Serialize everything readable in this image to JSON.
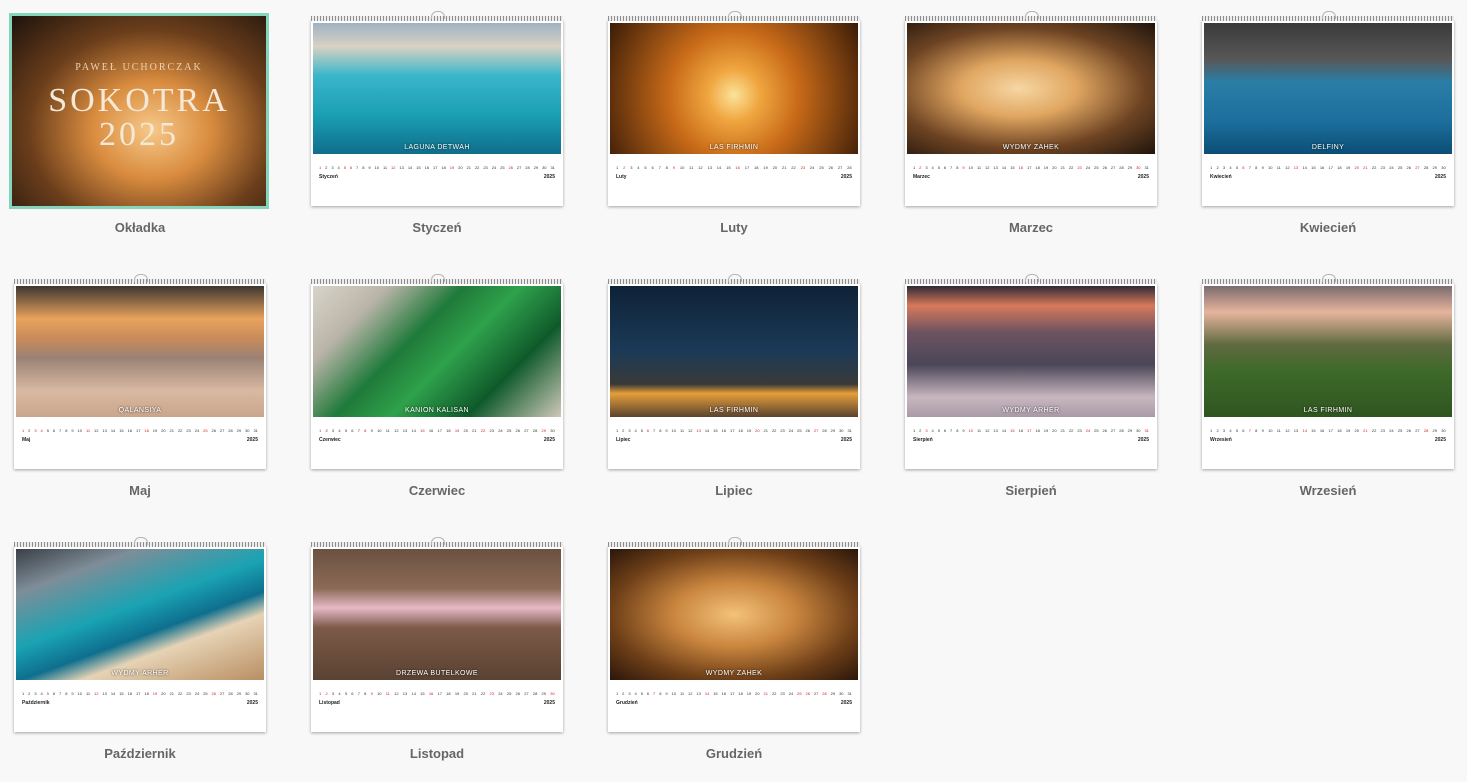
{
  "cover": {
    "author": "PAWEŁ UCHORCZAK",
    "title": "SOKOTRA",
    "year": "2025",
    "caption": "Okładka",
    "selected": true,
    "accent_color": "#83d6bc"
  },
  "calendar_year": "2025",
  "months": [
    {
      "caption": "Styczeń",
      "month_label": "Styczeń",
      "photo_title": "LAGUNA DETWAH",
      "day_count": 31,
      "red_days": [
        1,
        5,
        6,
        12,
        19,
        26
      ]
    },
    {
      "caption": "Luty",
      "month_label": "Luty",
      "photo_title": "LAS FIRHMIN",
      "day_count": 28,
      "red_days": [
        2,
        9,
        16,
        23
      ]
    },
    {
      "caption": "Marzec",
      "month_label": "Marzec",
      "photo_title": "WYDMY ZAHEK",
      "day_count": 31,
      "red_days": [
        2,
        9,
        16,
        23,
        30
      ]
    },
    {
      "caption": "Kwiecień",
      "month_label": "Kwiecień",
      "photo_title": "DELFINY",
      "day_count": 30,
      "red_days": [
        6,
        13,
        20,
        21,
        27
      ]
    },
    {
      "caption": "Maj",
      "month_label": "Maj",
      "photo_title": "QALANSIYA",
      "day_count": 31,
      "red_days": [
        1,
        3,
        4,
        11,
        18,
        25
      ]
    },
    {
      "caption": "Czerwiec",
      "month_label": "Czerwiec",
      "photo_title": "KANION KALISAN",
      "day_count": 30,
      "red_days": [
        1,
        8,
        15,
        19,
        22,
        29
      ]
    },
    {
      "caption": "Lipiec",
      "month_label": "Lipiec",
      "photo_title": "LAS FIRHMIN",
      "day_count": 31,
      "red_days": [
        6,
        13,
        20,
        27
      ]
    },
    {
      "caption": "Sierpień",
      "month_label": "Sierpień",
      "photo_title": "WYDMY ARHER",
      "day_count": 31,
      "red_days": [
        3,
        10,
        15,
        17,
        24,
        31
      ]
    },
    {
      "caption": "Wrzesień",
      "month_label": "Wrzesień",
      "photo_title": "LAS FIRHMIN",
      "day_count": 30,
      "red_days": [
        7,
        14,
        21,
        28
      ]
    },
    {
      "caption": "Październik",
      "month_label": "Październik",
      "photo_title": "WYDMY ARHER",
      "day_count": 31,
      "red_days": [
        5,
        12,
        19,
        26
      ]
    },
    {
      "caption": "Listopad",
      "month_label": "Listopad",
      "photo_title": "DRZEWA BUTELKOWE",
      "day_count": 30,
      "red_days": [
        1,
        2,
        9,
        11,
        16,
        23,
        30
      ]
    },
    {
      "caption": "Grudzień",
      "month_label": "Grudzień",
      "photo_title": "WYDMY ZAHEK",
      "day_count": 31,
      "red_days": [
        7,
        14,
        21,
        25,
        26,
        28
      ]
    }
  ],
  "photo_themes": [
    "linear-gradient(180deg,#9fb2c2 0%,#d8d2c4 18%,#3bb6c9 40%,#1a9fb5 70%,#0f6e8a 100%)",
    "radial-gradient(circle at 50% 55%,#fbe39a 0%,#f0a640 18%,#c86a18 45%,#3a1c08 100%)",
    "radial-gradient(ellipse at 45% 50%,#f6d7a3 0%,#e0a661 30%,#6e4423 65%,#1f140c 100%)",
    "linear-gradient(180deg,#3a3a3a 0%,#585858 28%,#2a7ea6 45%,#1c6e9c 75%,#0b4f76 100%)",
    "linear-gradient(180deg,#3c3530 0%,#e8a35d 25%,#c98b5a 40%,#9a8275 55%,#d9b9a2 80%,#c9a58b 100%)",
    "linear-gradient(135deg,#d9d4c9 0%,#b9b4a8 20%,#1f7a3a 40%,#2fa14b 55%,#0f5a2b 75%,#cfc8ba 100%)",
    "linear-gradient(180deg,#0e2236 0%,#1b3a57 50%,#3a3a38 75%,#e69e3a 82%,#5a4330 100%)",
    "linear-gradient(180deg,#2e2a36 0%,#d8795a 15%,#6e5360 35%,#4b4658 60%,#c8b7bf 85%,#a89aa6 100%)",
    "linear-gradient(180deg,#7a6c6e 0%,#e6b49c 20%,#5e6a3e 45%,#3e6a2a 65%,#2f5520 100%)",
    "linear-gradient(160deg,#3a3f46 0%,#7e8d98 20%,#1aa3b3 45%,#0e6f8e 60%,#e6d3b5 70%,#b98e62 100%)",
    "linear-gradient(180deg,#6b5142 0%,#8a6a55 30%,#e7b9c7 45%,#7c5a48 60%,#5a4233 100%)",
    "radial-gradient(ellipse at 50% 50%,#f3c27a 0%,#c9853e 35%,#6e3f18 70%,#2a160a 100%)"
  ],
  "cover_theme": "radial-gradient(ellipse at 55% 60%,#f6c98a 0%,#d98c3f 30%,#6b3e1b 62%,#1c120c 100%)"
}
